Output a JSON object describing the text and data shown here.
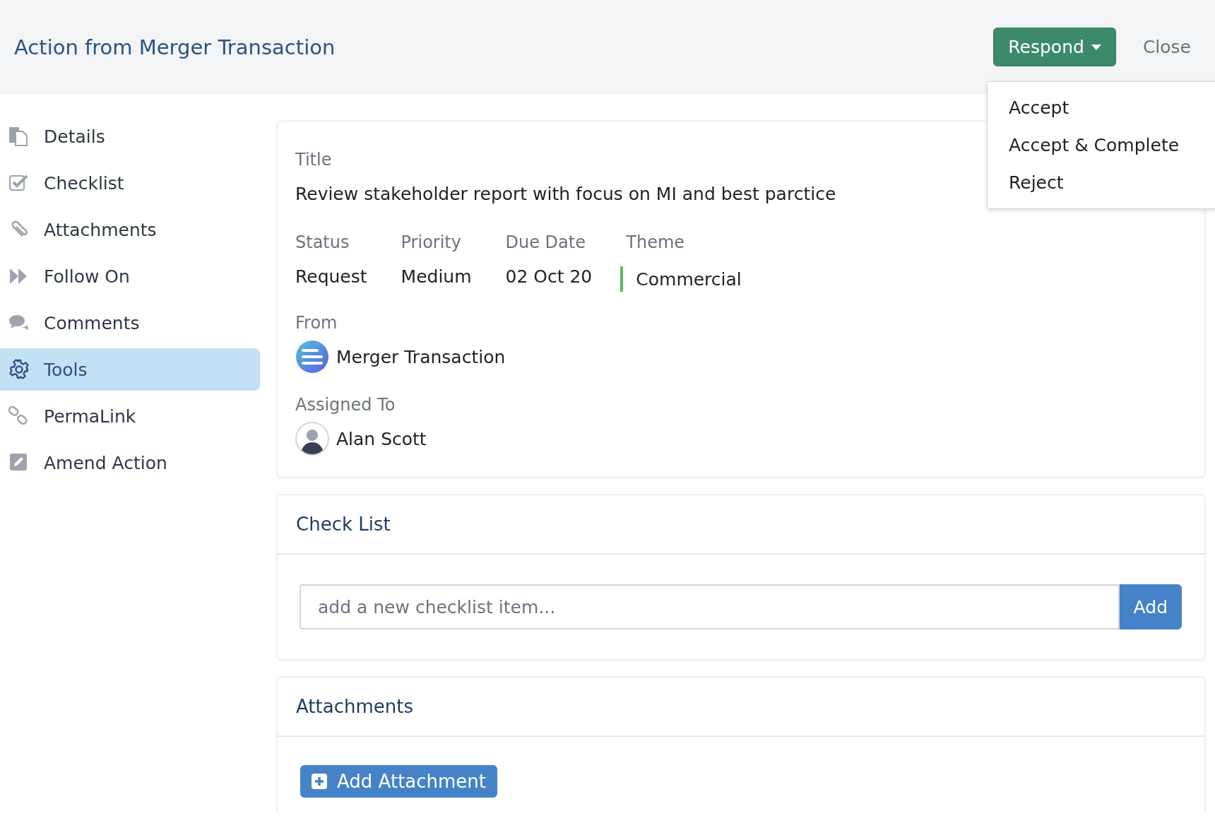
{
  "header": {
    "title": "Action from Merger Transaction",
    "respond_button": "Respond",
    "close_button": "Close"
  },
  "respond_menu": {
    "items": [
      "Accept",
      "Accept & Complete",
      "Reject"
    ]
  },
  "sidebar": {
    "items": [
      {
        "label": "Details",
        "kind": "details",
        "selected": false
      },
      {
        "label": "Checklist",
        "kind": "checklist",
        "selected": false
      },
      {
        "label": "Attachments",
        "kind": "attachments",
        "selected": false
      },
      {
        "label": "Follow On",
        "kind": "follow",
        "selected": false
      },
      {
        "label": "Comments",
        "kind": "comments",
        "selected": false
      },
      {
        "label": "Tools",
        "kind": "tools",
        "selected": true
      },
      {
        "label": "PermaLink",
        "kind": "link",
        "selected": false
      },
      {
        "label": "Amend Action",
        "kind": "amend",
        "selected": false
      }
    ]
  },
  "details": {
    "title_label": "Title",
    "title": "Review stakeholder report with focus on MI and best parctice",
    "fields": [
      {
        "label": "Status",
        "value": "Request"
      },
      {
        "label": "Priority",
        "value": "Medium"
      },
      {
        "label": "Due Date",
        "value": "02 Oct 20"
      },
      {
        "label": "Theme",
        "value": "Commercial",
        "color": "#5cb85c"
      }
    ],
    "from_label": "From",
    "from": "Merger Transaction",
    "assigned_label": "Assigned To",
    "assigned": "Alan Scott"
  },
  "checklist": {
    "heading": "Check List",
    "placeholder": "add a new checklist item...",
    "add_button": "Add"
  },
  "attachments": {
    "heading": "Attachments",
    "add_button": "Add Attachment"
  }
}
